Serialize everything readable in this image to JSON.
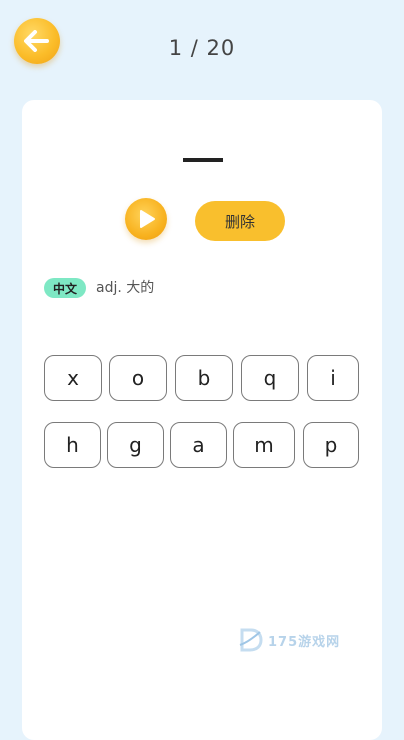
{
  "header": {
    "back_icon": "back-arrow-icon",
    "progress": "1 / 20"
  },
  "word": {
    "play_icon": "play-icon",
    "delete_label": "删除",
    "lang_tag": "中文",
    "definition": "adj. 大的"
  },
  "keyboard": {
    "rows": [
      [
        "x",
        "o",
        "b",
        "q",
        "i"
      ],
      [
        "h",
        "g",
        "a",
        "m",
        "p"
      ]
    ]
  },
  "watermark": {
    "text": "175游戏网"
  },
  "colors": {
    "background": "#e6f3fc",
    "accent": "#f9bf2d",
    "tag": "#7ee8c4"
  }
}
